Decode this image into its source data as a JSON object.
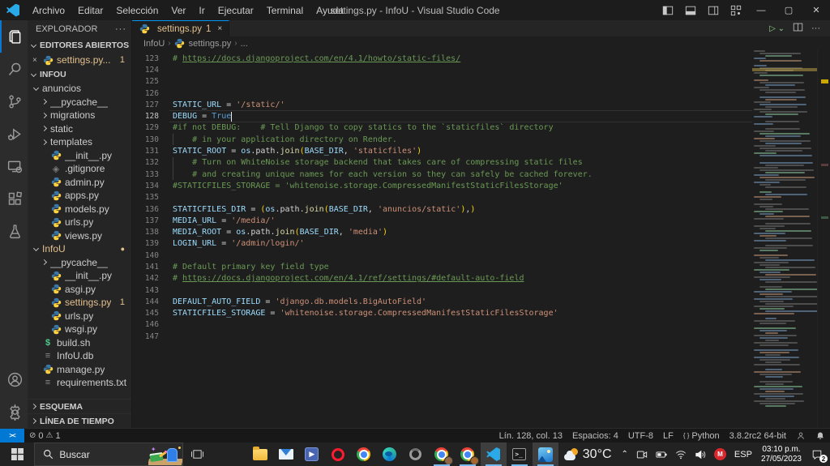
{
  "window": {
    "title": "settings.py - InfoU - Visual Studio Code",
    "menus": [
      "Archivo",
      "Editar",
      "Selección",
      "Ver",
      "Ir",
      "Ejecutar",
      "Terminal",
      "Ayuda"
    ],
    "layout_icons": [
      "layout-sidebar-left",
      "layout-panel",
      "layout-sidebar-right",
      "layout-customize"
    ],
    "controls": [
      "minimize",
      "maximize",
      "close"
    ]
  },
  "activity_bar": {
    "top": [
      {
        "name": "explorer",
        "active": true
      },
      {
        "name": "search"
      },
      {
        "name": "source-control"
      },
      {
        "name": "run-debug"
      },
      {
        "name": "remote-explorer"
      },
      {
        "name": "extensions"
      },
      {
        "name": "testing"
      }
    ],
    "bottom": [
      {
        "name": "account"
      },
      {
        "name": "settings"
      }
    ]
  },
  "explorer": {
    "title": "EXPLORADOR",
    "more": "···",
    "sections": {
      "open_editors": "EDITORES ABIERTOS",
      "root": "INFOU",
      "outline": "ESQUEMA",
      "timeline": "LÍNEA DE TIEMPO"
    },
    "open_editor": {
      "close": "×",
      "label": "settings.py...",
      "badge": "1"
    },
    "tree": [
      {
        "label": "anuncios",
        "type": "folder",
        "expanded": true,
        "level": 0
      },
      {
        "label": "__pycache__",
        "type": "folder",
        "level": 1
      },
      {
        "label": "migrations",
        "type": "folder",
        "level": 1
      },
      {
        "label": "static",
        "type": "folder",
        "level": 1
      },
      {
        "label": "templates",
        "type": "folder",
        "level": 1
      },
      {
        "label": "__init__.py",
        "type": "python",
        "level": 1
      },
      {
        "label": ".gitignore",
        "type": "git",
        "level": 1
      },
      {
        "label": "admin.py",
        "type": "python",
        "level": 1
      },
      {
        "label": "apps.py",
        "type": "python",
        "level": 1
      },
      {
        "label": "models.py",
        "type": "python",
        "level": 1
      },
      {
        "label": "urls.py",
        "type": "python",
        "level": 1
      },
      {
        "label": "views.py",
        "type": "python",
        "level": 1
      },
      {
        "label": "InfoU",
        "type": "folder",
        "expanded": true,
        "level": 0,
        "modified": true,
        "dot": "●"
      },
      {
        "label": "__pycache__",
        "type": "folder",
        "level": 1
      },
      {
        "label": "__init__.py",
        "type": "python",
        "level": 1
      },
      {
        "label": "asgi.py",
        "type": "python",
        "level": 1
      },
      {
        "label": "settings.py",
        "type": "python",
        "level": 1,
        "modified": true,
        "badge": "1"
      },
      {
        "label": "urls.py",
        "type": "python",
        "level": 1
      },
      {
        "label": "wsgi.py",
        "type": "python",
        "level": 1
      },
      {
        "label": "build.sh",
        "type": "shell",
        "level": 0
      },
      {
        "label": "InfoU.db",
        "type": "text",
        "level": 0
      },
      {
        "label": "manage.py",
        "type": "python",
        "level": 0
      },
      {
        "label": "requirements.txt",
        "type": "text",
        "level": 0
      }
    ]
  },
  "editor": {
    "tab": {
      "label": "settings.py",
      "badge": "1",
      "close": "×"
    },
    "actions": {
      "run": "▷",
      "run_dropdown": "⌄",
      "more": "···"
    },
    "breadcrumb": {
      "root": "InfoU",
      "file": "settings.py",
      "more": "..."
    },
    "lines": [
      {
        "n": "123",
        "s": [
          [
            "cm",
            "# "
          ],
          [
            "lk",
            "https://docs.djangoproject.com/en/4.1/howto/static-files/"
          ]
        ]
      },
      {
        "n": "124",
        "s": []
      },
      {
        "n": "125",
        "s": []
      },
      {
        "n": "126",
        "s": []
      },
      {
        "n": "127",
        "s": [
          [
            "v",
            "STATIC_URL"
          ],
          [
            "o",
            " = "
          ],
          [
            "s",
            "'/static/'"
          ]
        ]
      },
      {
        "n": "128",
        "cur": true,
        "s": [
          [
            "v",
            "DEBUG"
          ],
          [
            "o",
            " = "
          ],
          [
            "k",
            "True"
          ]
        ]
      },
      {
        "n": "129",
        "s": [
          [
            "cm",
            "#if not DEBUG:    # Tell Django to copy statics to the `staticfiles` directory"
          ]
        ]
      },
      {
        "n": "130",
        "g": true,
        "s": [
          [
            "cm",
            "    # in your application directory on Render."
          ]
        ]
      },
      {
        "n": "131",
        "s": [
          [
            "v",
            "STATIC_ROOT"
          ],
          [
            "o",
            " = "
          ],
          [
            "v",
            "os"
          ],
          [
            "o",
            "."
          ],
          [
            "t",
            "path"
          ],
          [
            "o",
            "."
          ],
          [
            "f",
            "join"
          ],
          [
            "b",
            "("
          ],
          [
            "v",
            "BASE_DIR"
          ],
          [
            "o",
            ", "
          ],
          [
            "s",
            "'staticfiles'"
          ],
          [
            "b",
            ")"
          ]
        ]
      },
      {
        "n": "132",
        "g": true,
        "s": [
          [
            "cm",
            "    # Turn on WhiteNoise storage backend that takes care of compressing static files"
          ]
        ]
      },
      {
        "n": "133",
        "g": true,
        "s": [
          [
            "cm",
            "    # and creating unique names for each version so they can safely be cached forever."
          ]
        ]
      },
      {
        "n": "134",
        "s": [
          [
            "cm",
            "#STATICFILES_STORAGE = 'whitenoise.storage.CompressedManifestStaticFilesStorage'"
          ]
        ]
      },
      {
        "n": "135",
        "s": []
      },
      {
        "n": "136",
        "s": [
          [
            "v",
            "STATICFILES_DIR"
          ],
          [
            "o",
            " = "
          ],
          [
            "b",
            "("
          ],
          [
            "v",
            "os"
          ],
          [
            "o",
            "."
          ],
          [
            "t",
            "path"
          ],
          [
            "o",
            "."
          ],
          [
            "f",
            "join"
          ],
          [
            "b",
            "("
          ],
          [
            "v",
            "BASE_DIR"
          ],
          [
            "o",
            ", "
          ],
          [
            "s",
            "'anuncios/static'"
          ],
          [
            "b",
            ")"
          ],
          [
            "o",
            ","
          ],
          [
            "b",
            ")"
          ]
        ]
      },
      {
        "n": "137",
        "s": [
          [
            "v",
            "MEDIA_URL"
          ],
          [
            "o",
            " = "
          ],
          [
            "s",
            "'/media/'"
          ]
        ]
      },
      {
        "n": "138",
        "s": [
          [
            "v",
            "MEDIA_ROOT"
          ],
          [
            "o",
            " = "
          ],
          [
            "v",
            "os"
          ],
          [
            "o",
            "."
          ],
          [
            "t",
            "path"
          ],
          [
            "o",
            "."
          ],
          [
            "f",
            "join"
          ],
          [
            "b",
            "("
          ],
          [
            "v",
            "BASE_DIR"
          ],
          [
            "o",
            ", "
          ],
          [
            "s",
            "'media'"
          ],
          [
            "b",
            ")"
          ]
        ]
      },
      {
        "n": "139",
        "s": [
          [
            "v",
            "LOGIN_URL"
          ],
          [
            "o",
            " = "
          ],
          [
            "s",
            "'/admin/login/'"
          ]
        ]
      },
      {
        "n": "140",
        "s": []
      },
      {
        "n": "141",
        "s": [
          [
            "cm",
            "# Default primary key field type"
          ]
        ]
      },
      {
        "n": "142",
        "s": [
          [
            "cm",
            "# "
          ],
          [
            "lk",
            "https://docs.djangoproject.com/en/4.1/ref/settings/#default-auto-field"
          ]
        ]
      },
      {
        "n": "143",
        "s": []
      },
      {
        "n": "144",
        "s": [
          [
            "v",
            "DEFAULT_AUTO_FIELD"
          ],
          [
            "o",
            " = "
          ],
          [
            "s",
            "'django.db.models.BigAutoField'"
          ]
        ]
      },
      {
        "n": "145",
        "s": [
          [
            "v",
            "STATICFILES_STORAGE"
          ],
          [
            "o",
            " = "
          ],
          [
            "s",
            "'whitenoise.storage.CompressedManifestStaticFilesStorage'"
          ]
        ]
      },
      {
        "n": "146",
        "s": []
      },
      {
        "n": "147",
        "s": []
      }
    ]
  },
  "status_bar": {
    "remote_icon": "><",
    "errors": "0",
    "warnings": "1",
    "line_col": "Lín. 128, col. 13",
    "spaces": "Espacios: 4",
    "encoding": "UTF-8",
    "eol": "LF",
    "language_icon": "{ }",
    "language": "Python",
    "interpreter": "3.8.2rc2 64-bit"
  },
  "taskbar": {
    "search_placeholder": "Buscar",
    "apps": [
      {
        "name": "file-explorer"
      },
      {
        "name": "mail"
      },
      {
        "name": "movies-tv"
      },
      {
        "name": "opera"
      },
      {
        "name": "chrome"
      },
      {
        "name": "edge"
      },
      {
        "name": "app-grey"
      },
      {
        "name": "chrome-profile-1",
        "open": true
      },
      {
        "name": "chrome-profile-2",
        "open": true
      },
      {
        "name": "vscode",
        "active": true,
        "open": true
      },
      {
        "name": "terminal",
        "open": true
      },
      {
        "name": "photos",
        "active": true,
        "open": true
      }
    ],
    "tray": {
      "weather_temp": "30°C",
      "language": "ESP",
      "time": "03:10 p.m.",
      "date": "27/05/2023",
      "notification_count": "2"
    }
  }
}
